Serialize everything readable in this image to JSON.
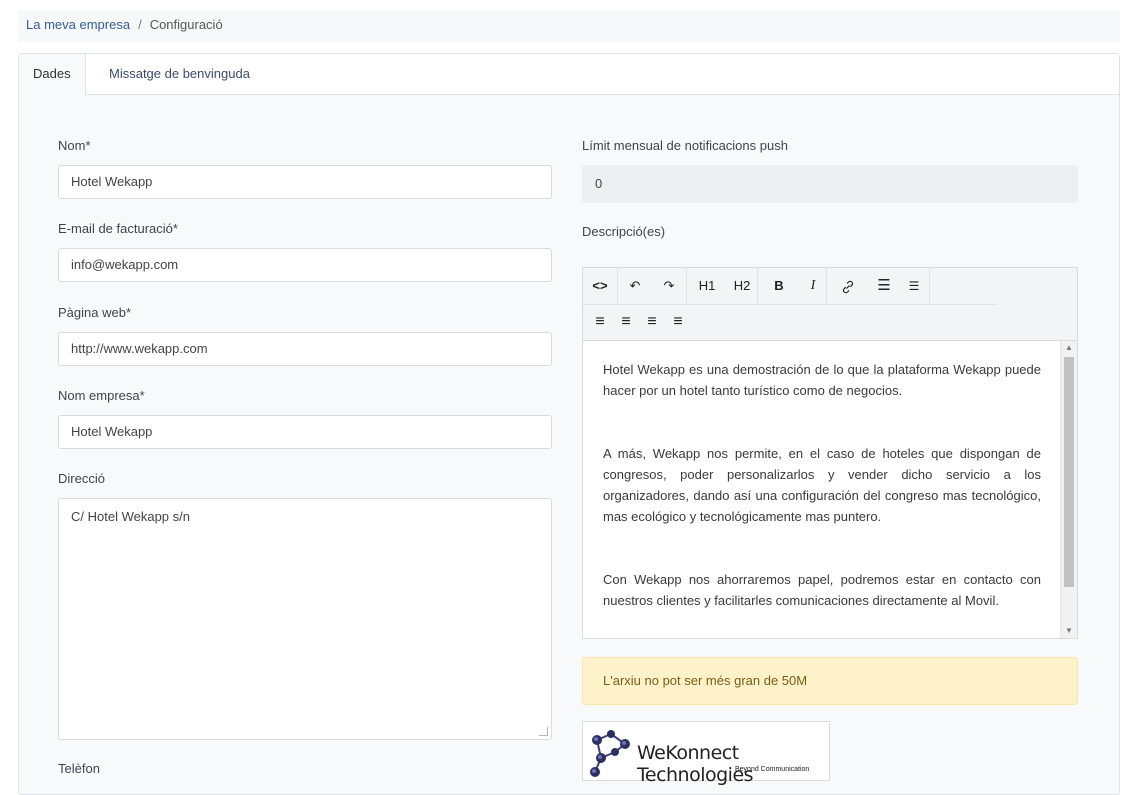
{
  "breadcrumb": {
    "parent": "La meva empresa",
    "separator": "/",
    "current": "Configuració"
  },
  "tabs": [
    {
      "label": "Dades",
      "active": true
    },
    {
      "label": "Missatge de benvinguda",
      "active": false
    }
  ],
  "form": {
    "name": {
      "label": "Nom*",
      "value": "Hotel Wekapp"
    },
    "billing_email": {
      "label": "E-mail de facturació*",
      "value": "info@wekapp.com"
    },
    "website": {
      "label": "Pàgina web*",
      "value": "http://www.wekapp.com"
    },
    "company_name": {
      "label": "Nom empresa*",
      "value": "Hotel Wekapp"
    },
    "address": {
      "label": "Direcció",
      "value": "C/ Hotel Wekapp s/n"
    },
    "phone": {
      "label": "Telèfon"
    },
    "push_limit": {
      "label": "Límit mensual de notificacions push",
      "value": "0"
    },
    "description": {
      "label": "Descripció(es)",
      "paragraphs": [
        "Hotel Wekapp es una demostración de lo que la plataforma Wekapp puede hacer por un hotel tanto turístico como de negocios.",
        " A más, Wekapp nos permite, en el caso de hoteles que dispongan de congresos, poder personalizarlos y vender dicho servicio a los organizadores, dando así una configuración del congreso mas tecnológico, mas ecológico y tecnológicamente mas puntero.",
        "Con Wekapp nos ahorraremos papel, podremos estar en contacto con nuestros clientes y facilitarles comunicaciones directamente al Movil."
      ]
    }
  },
  "toolbar": {
    "code": "<>",
    "undo": "↶",
    "redo": "↷",
    "h1": "H1",
    "h2": "H2",
    "bold": "B",
    "italic": "I",
    "link": "🔗",
    "bullet_list": "☰",
    "ordered_list": "☰",
    "align_left": "≡",
    "align_center": "≡",
    "align_right": "≡",
    "align_justify": "≡"
  },
  "file_alert": "L'arxiu no pot ser més gran de 50M",
  "logo": {
    "name": "WeKonnect Technologies",
    "tagline": "Beyond Communication"
  }
}
